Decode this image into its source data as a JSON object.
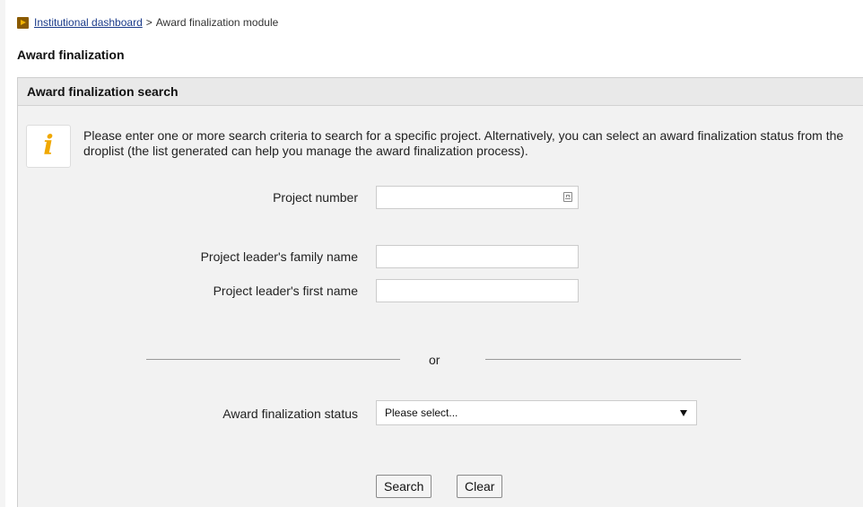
{
  "breadcrumb": {
    "icon": "breadcrumb-arrow-icon",
    "link_label": "Institutional dashboard",
    "separator": ">",
    "current_label": "Award finalization module"
  },
  "page": {
    "title": "Award finalization"
  },
  "panel": {
    "header": "Award finalization search",
    "info_icon": "info-icon",
    "info_text": "Please enter one or more search criteria to search for a specific project. Alternatively, you can select an award finalization status from the droplist (the list generated can help you manage the award finalization process)."
  },
  "fields": {
    "project_number": {
      "label": "Project number",
      "value": "",
      "icon": "input-helper-icon"
    },
    "family_name": {
      "label": "Project leader's family name",
      "value": ""
    },
    "first_name": {
      "label": "Project leader's first name",
      "value": ""
    }
  },
  "divider": {
    "text": "or"
  },
  "status": {
    "label": "Award finalization status",
    "selected": "Please select..."
  },
  "buttons": {
    "search": "Search",
    "clear": "Clear"
  }
}
